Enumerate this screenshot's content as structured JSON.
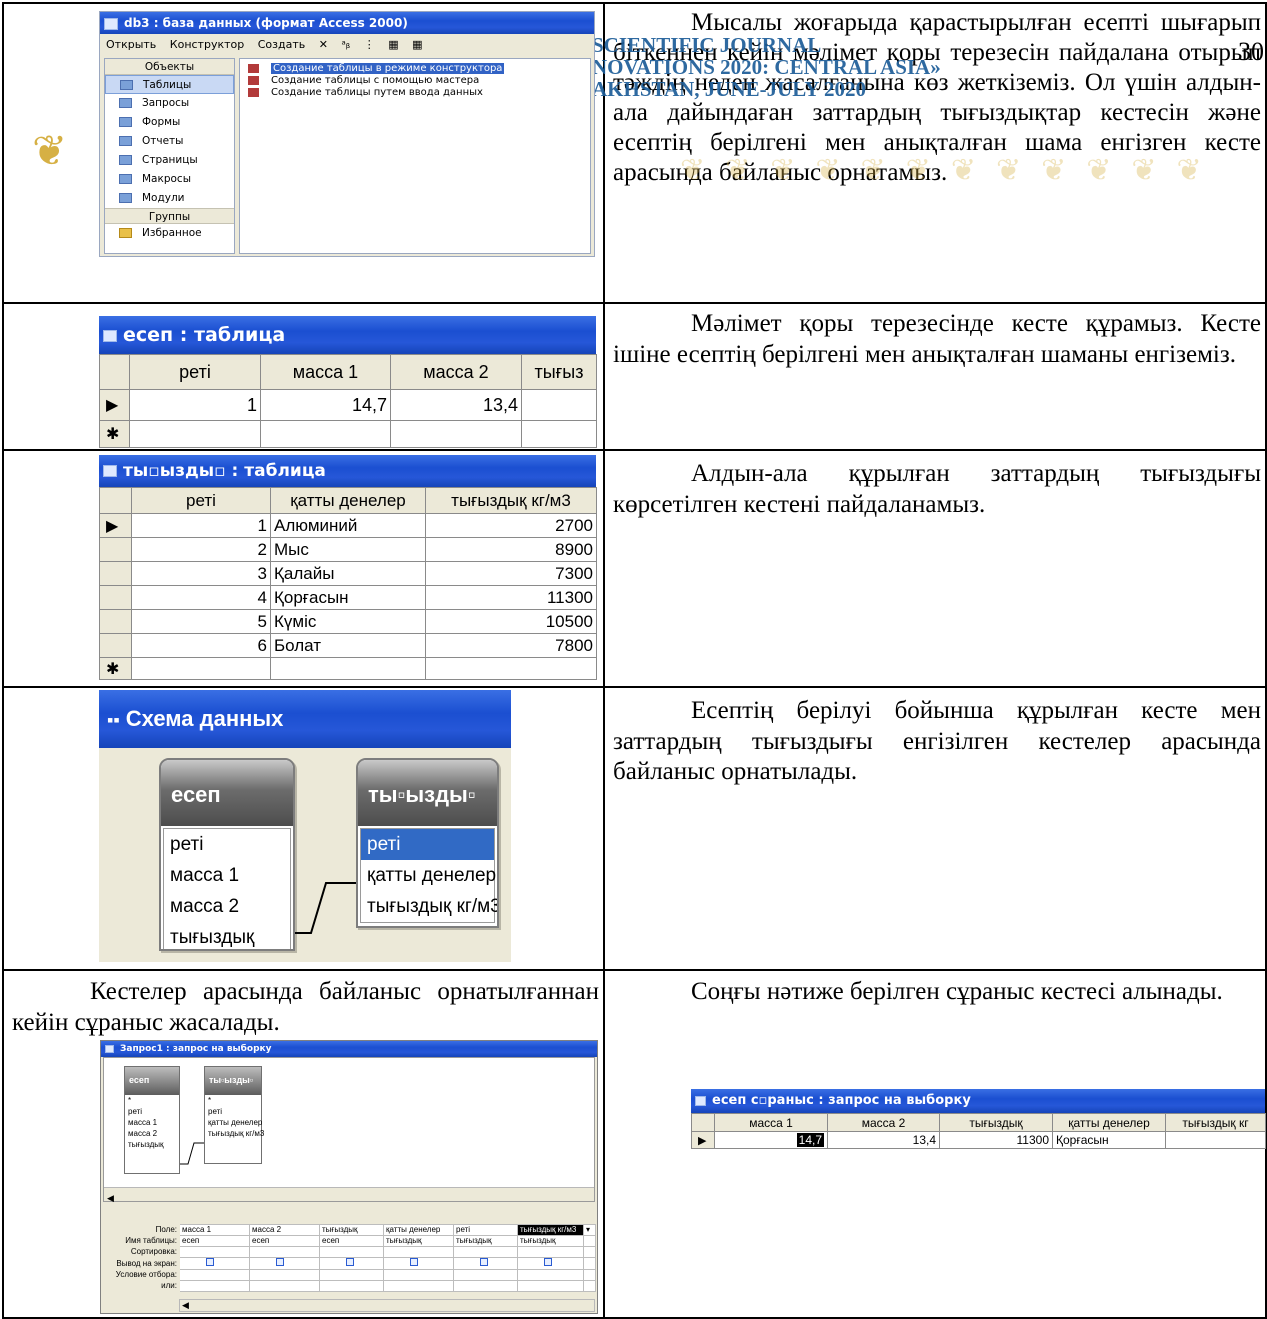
{
  "header": {
    "journal_line1": "SCIENTIFIC JOURNAL",
    "journal_line2": "NOVATIONS 2020: CENTRAL ASIA»",
    "journal_line3": "AKHSTAN, JUNE-JULY 2020",
    "page_number": "30"
  },
  "paragraphs": {
    "p1": "Мысалы жоғарыда қарастырылған есепті шығарып біткеннен кейін мәлімет қоры терезесін пайдалана отырып тәждің неден жасалғанына көз жеткіземіз. Ол үшін алдын-ала дайындаған заттардың тығыздықтар кестесін және есептің берілгені мен анықталған шама енгізген кесте арасында байланыс орнатамыз.",
    "p2": "Мәлімет қоры терезесінде кесте құрамыз. Кесте ішіне есептің берілгені мен анықталған шаманы енгіземіз.",
    "p3": "Алдын-ала құрылған заттардың тығыздығы көрсетілген кестені пайдаланамыз.",
    "p4": "Есептің берілуі бойынша құрылған кесте мен заттардың тығыздығы енгізілген кестелер арасында байланыс орнатылады.",
    "p5": "Кестелер арасында байланыс орнатылғаннан кейін сұраныс жасалады.",
    "p6": "Соңғы нәтиже берілген сұраныс кестесі алынады."
  },
  "db_window": {
    "title": "db3 : база данных (формат Access 2000)",
    "toolbar": [
      "Открыть",
      "Конструктор",
      "Создать",
      "✕",
      "ᵃᵦ",
      "⋮",
      "▦",
      "▦"
    ],
    "objects_caption": "Объекты",
    "objects": [
      "Таблицы",
      "Запросы",
      "Формы",
      "Отчеты",
      "Страницы",
      "Макросы",
      "Модули"
    ],
    "groups_caption": "Группы",
    "groups": [
      "Избранное"
    ],
    "items": [
      "Создание таблицы в режиме конструктора",
      "Создание таблицы с помощью мастера",
      "Создание таблицы путем ввода данных"
    ]
  },
  "esep_table": {
    "title": "есеп : таблица",
    "columns": [
      "реті",
      "масса 1",
      "масса 2",
      "тығыз"
    ],
    "row": [
      "1",
      "14,7",
      "13,4",
      ""
    ]
  },
  "density_table": {
    "title": "ты▫ызды▫ : таблица",
    "columns": [
      "реті",
      "қатты денелер",
      "тығыздық кг/м3"
    ],
    "rows": [
      [
        "1",
        "Алюминий",
        "2700"
      ],
      [
        "2",
        "Мыс",
        "8900"
      ],
      [
        "3",
        "Қалайы",
        "7300"
      ],
      [
        "4",
        "Қорғасын",
        "11300"
      ],
      [
        "5",
        "Күміс",
        "10500"
      ],
      [
        "6",
        "Болат",
        "7800"
      ]
    ]
  },
  "schema": {
    "title": "Схема данных",
    "table1_name": "есеп",
    "table1_fields": [
      "реті",
      "масса 1",
      "масса 2",
      "тығыздық"
    ],
    "table2_name": "ты▫ызды▫",
    "table2_fields": [
      "реті",
      "қатты денелер",
      "тығыздық кг/м3"
    ]
  },
  "query": {
    "title": "Запрос1 : запрос на выборку",
    "box1_name": "есеп",
    "box1_fields": [
      "*",
      "реті",
      "масса 1",
      "масса 2",
      "тығыздық"
    ],
    "box2_name": "ты▫ызды▫",
    "box2_fields": [
      "*",
      "реті",
      "қатты денелер",
      "тығыздық кг/м3"
    ],
    "row_labels": [
      "Поле:",
      "Имя таблицы:",
      "Сортировка:",
      "Вывод на экран:",
      "Условие отбора:",
      "или:"
    ],
    "fields": [
      "масса 1",
      "масса 2",
      "тығыздық",
      "қатты денелер",
      "реті",
      "тығыздық кг/м3"
    ],
    "tables": [
      "есеп",
      "есеп",
      "есеп",
      "тығыздық",
      "тығыздық",
      "тығыздық"
    ]
  },
  "result_query": {
    "title": "есеп с▫раныс : запрос на выборку",
    "columns": [
      "масса 1",
      "масса 2",
      "тығыздық",
      "қатты денелер",
      "тығыздық кг"
    ],
    "row": [
      "14,7",
      "13,4",
      "11300",
      "Қорғасын",
      ""
    ]
  }
}
